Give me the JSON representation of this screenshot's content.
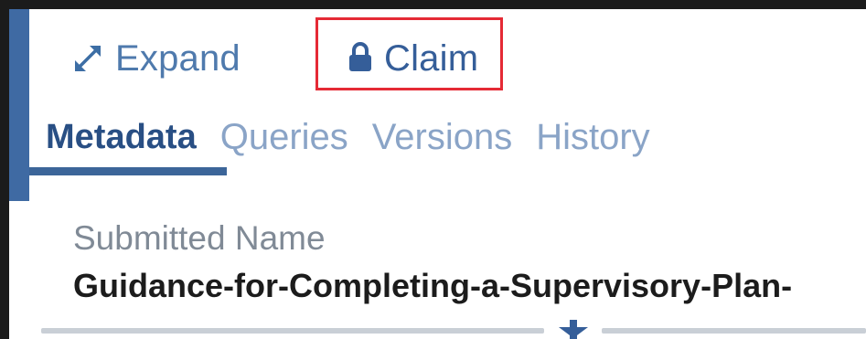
{
  "toolbar": {
    "expand_label": "Expand",
    "claim_label": "Claim"
  },
  "tabs": [
    {
      "label": "Metadata",
      "active": true
    },
    {
      "label": "Queries",
      "active": false
    },
    {
      "label": "Versions",
      "active": false
    },
    {
      "label": "History",
      "active": false
    }
  ],
  "field": {
    "label": "Submitted Name",
    "value": "Guidance-for-Completing-a-Supervisory-Plan-"
  },
  "colors": {
    "accent": "#3d6ea5",
    "highlight": "#e52a35",
    "tab_inactive": "#8aa4c7"
  },
  "icons": {
    "expand": "expand-arrows-icon",
    "claim": "lock-icon",
    "handle": "drag-handle-icon"
  }
}
